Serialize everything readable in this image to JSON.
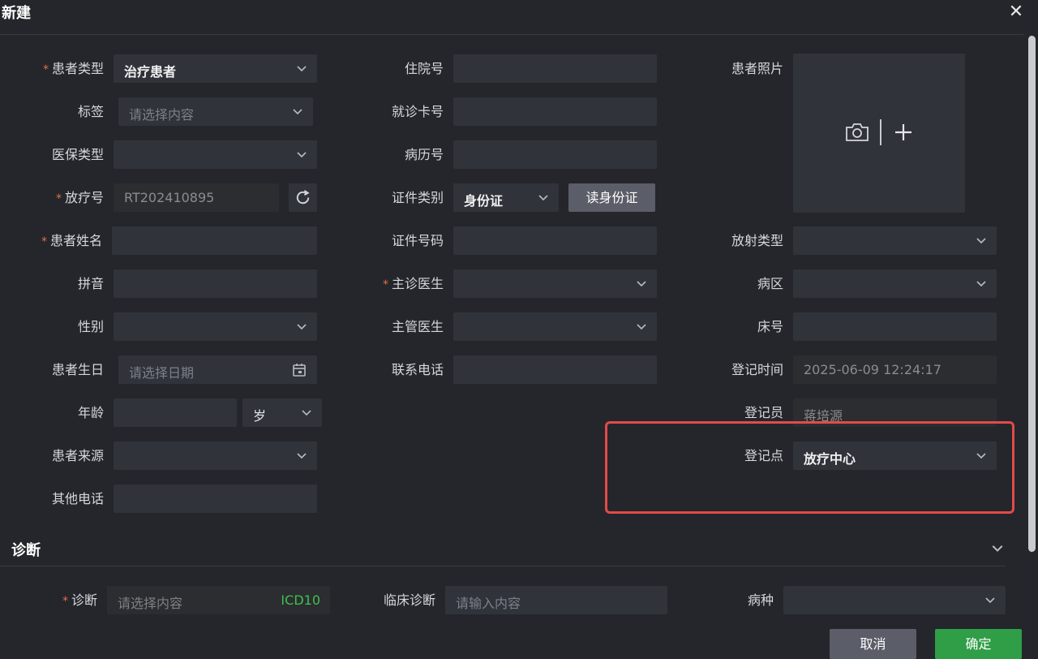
{
  "dialog": {
    "title": "新建"
  },
  "left": {
    "patient_type": {
      "label": "患者类型",
      "value": "治疗患者"
    },
    "tag": {
      "label": "标签",
      "placeholder": "请选择内容"
    },
    "insurance_type": {
      "label": "医保类型",
      "value": ""
    },
    "radiotherapy_no": {
      "label": "放疗号",
      "value": "RT202410895"
    },
    "patient_name": {
      "label": "患者姓名",
      "value": ""
    },
    "pinyin": {
      "label": "拼音",
      "value": ""
    },
    "gender": {
      "label": "性别",
      "value": ""
    },
    "birthday": {
      "label": "患者生日",
      "placeholder": "请选择日期"
    },
    "age": {
      "label": "年龄",
      "value": "",
      "unit": "岁"
    },
    "patient_source": {
      "label": "患者来源",
      "value": ""
    },
    "other_phone": {
      "label": "其他电话",
      "value": ""
    }
  },
  "middle": {
    "inpatient_no": {
      "label": "住院号",
      "value": ""
    },
    "visit_card_no": {
      "label": "就诊卡号",
      "value": ""
    },
    "medical_record_no": {
      "label": "病历号",
      "value": ""
    },
    "id_type": {
      "label": "证件类别",
      "value": "身份证",
      "read_button": "读身份证"
    },
    "id_number": {
      "label": "证件号码",
      "value": ""
    },
    "attending_doctor": {
      "label": "主诊医生",
      "value": ""
    },
    "supervising_doctor": {
      "label": "主管医生",
      "value": ""
    },
    "phone": {
      "label": "联系电话",
      "value": ""
    }
  },
  "right": {
    "photo": {
      "label": "患者照片"
    },
    "radiation_type": {
      "label": "放射类型",
      "value": ""
    },
    "ward": {
      "label": "病区",
      "value": ""
    },
    "bed_no": {
      "label": "床号",
      "value": ""
    },
    "register_time": {
      "label": "登记时间",
      "value": "2025-06-09 12:24:17"
    },
    "registrar": {
      "label": "登记员",
      "value": "蒋培源"
    },
    "register_point": {
      "label": "登记点",
      "value": "放疗中心"
    }
  },
  "diagnosis": {
    "section_title": "诊断",
    "diagnosis": {
      "label": "诊断",
      "placeholder": "请选择内容",
      "code_tag": "ICD10"
    },
    "clinical_diagnosis": {
      "label": "临床诊断",
      "placeholder": "请输入内容"
    },
    "disease_type": {
      "label": "病种",
      "value": ""
    }
  },
  "footer": {
    "cancel": "取消",
    "confirm": "确定"
  },
  "colors": {
    "required": "#e2704b",
    "highlight": "#e24a4a",
    "confirm": "#2f9e47",
    "icd": "#3fbf4f"
  }
}
